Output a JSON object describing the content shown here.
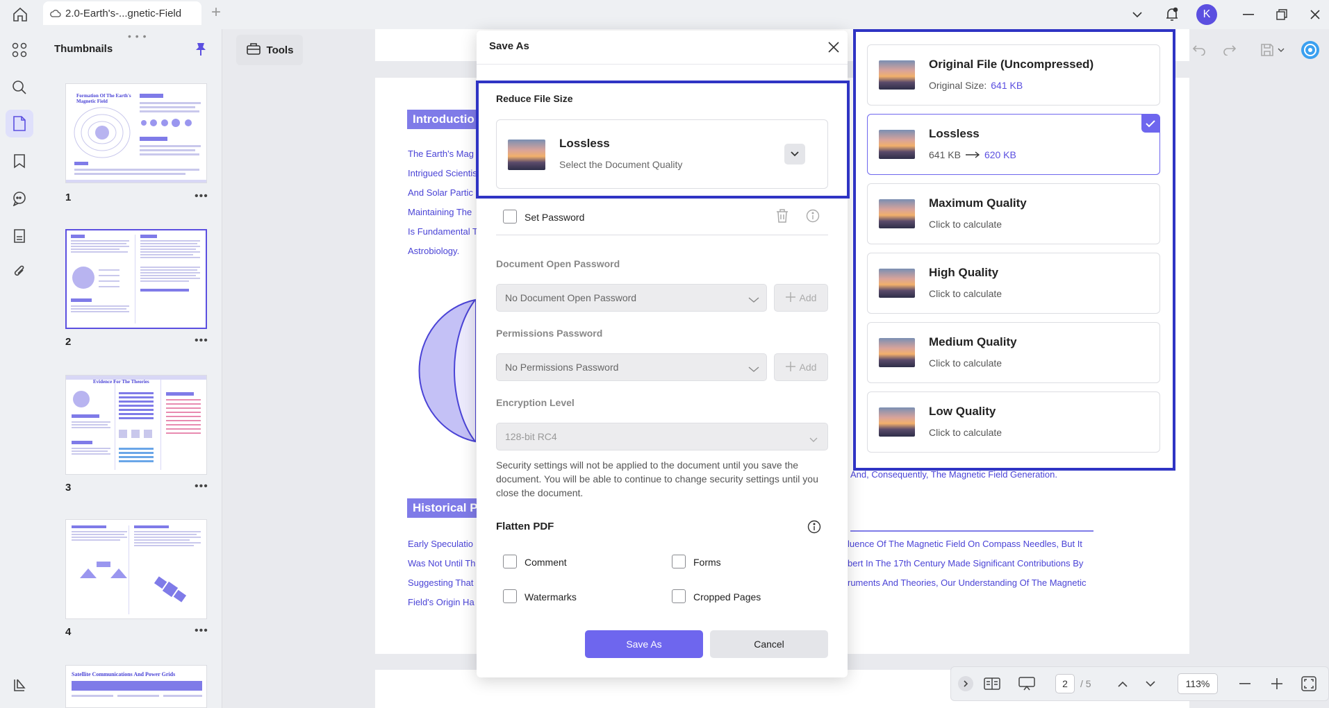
{
  "titlebar": {
    "tab_title": "2.0-Earth's-...gnetic-Field",
    "avatar_letter": "K"
  },
  "thumbnails": {
    "title": "Thumbnails",
    "pages": [
      {
        "number": "1",
        "heading": "Formation Of The Earth's Magnetic Field"
      },
      {
        "number": "2"
      },
      {
        "number": "3",
        "heading": "Evidence For The Theories"
      },
      {
        "number": "4"
      },
      {
        "heading": "Satellite Communications And Power Grids"
      }
    ]
  },
  "toolbar": {
    "tools_label": "Tools"
  },
  "document": {
    "intro_heading": "Introductio",
    "intro_lines": [
      "The Earth's Mag",
      "Intrigued Scientis",
      "And Solar Partic",
      "Maintaining The",
      "Is Fundamental T",
      "Astrobiology."
    ],
    "historical_heading": "Historical P",
    "historical_lines": [
      "Early Speculatio",
      "Was Not Until Th",
      "Suggesting That",
      "Field's Origin Ha"
    ],
    "right_line_1": "And, Consequently, The Magnetic Field Generation.",
    "right_lines": [
      "luence Of The Magnetic Field On Compass Needles, But It",
      "bert In The 17th Century Made Significant Contributions By",
      "ruments And Theories, Our Understanding Of The Magnetic"
    ]
  },
  "statusbar": {
    "current_page": "2",
    "total_pages": "/ 5",
    "zoom": "113%"
  },
  "dialog": {
    "title": "Save As",
    "reduce_label": "Reduce File Size",
    "selected_quality": {
      "title": "Lossless",
      "subtitle": "Select the Document Quality"
    },
    "set_password_label": "Set Password",
    "open_password_label": "Document Open Password",
    "open_password_value": "No Document Open Password",
    "permissions_label": "Permissions Password",
    "permissions_value": "No Permissions Password",
    "add_label": "Add",
    "encryption_label": "Encryption Level",
    "encryption_value": "128-bit RC4",
    "security_note": "Security settings will not be applied to the document until you save the document. You will be able to continue to change security settings until you close the document.",
    "flatten_label": "Flatten PDF",
    "flatten_options": [
      "Comment",
      "Forms",
      "Watermarks",
      "Cropped Pages"
    ],
    "save_button": "Save As",
    "cancel_button": "Cancel"
  },
  "quality_options": [
    {
      "title": "Original File (Uncompressed)",
      "prefix": "Original Size:",
      "value": "641 KB"
    },
    {
      "title": "Lossless",
      "from": "641 KB",
      "to": "620 KB",
      "selected": true
    },
    {
      "title": "Maximum Quality",
      "sub": "Click to calculate"
    },
    {
      "title": "High Quality",
      "sub": "Click to calculate"
    },
    {
      "title": "Medium Quality",
      "sub": "Click to calculate"
    },
    {
      "title": "Low Quality",
      "sub": "Click to calculate"
    }
  ],
  "colors": {
    "accent": "#6e66ee",
    "highlight": "#2f34c4",
    "doc_text": "#4a43d6"
  }
}
